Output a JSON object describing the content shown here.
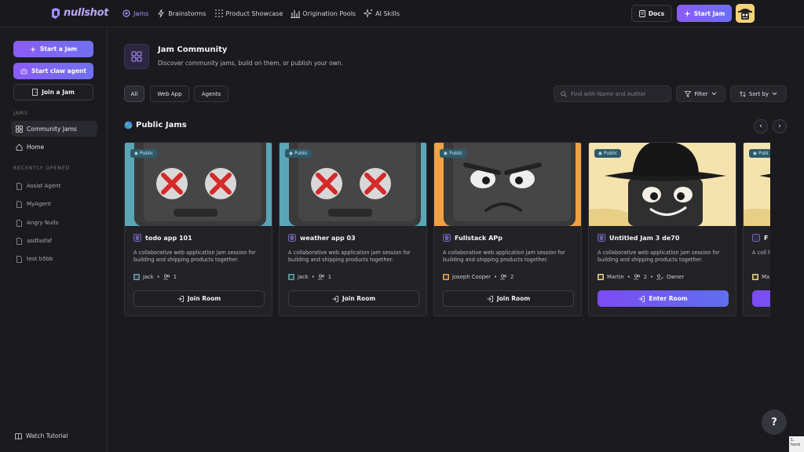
{
  "brand": {
    "name": "nullshot"
  },
  "nav": {
    "items": [
      {
        "label": "Jams",
        "icon": "jams-icon",
        "active": true
      },
      {
        "label": "Brainstorms",
        "icon": "bolt-icon"
      },
      {
        "label": "Product Showcase",
        "icon": "grid-dots-icon"
      },
      {
        "label": "Origination Pools",
        "icon": "bar-chart-icon"
      },
      {
        "label": "AI Skills",
        "icon": "sparkle-icon"
      }
    ],
    "docs_label": "Docs",
    "start_jam_label": "Start Jam"
  },
  "sidebar": {
    "start_jam": "Start a Jam",
    "start_claw": "Start claw agent",
    "join_jam": "Join a Jam",
    "section_jams": "JAMS",
    "community": "Community Jams",
    "home": "Home",
    "section_recent": "RECENTLY OPENED",
    "recent": [
      "Assist Agent",
      "MyAgent",
      "Angry Nulls",
      "asdfasfaf",
      "test b5bb"
    ],
    "watch": "Watch Tutorial"
  },
  "header": {
    "title": "Jam Community",
    "subtitle": "Discover community jams, build on them, or publish your own."
  },
  "filters": {
    "all": "All",
    "web_app": "Web App",
    "agents": "Agents"
  },
  "search": {
    "placeholder": "Find with Name and Author"
  },
  "toolbar": {
    "filter": "Filter",
    "sort": "Sort by"
  },
  "section": {
    "title": "Public Jams",
    "icon": "globe-icon"
  },
  "cards": [
    {
      "badge": "Public",
      "title": "todo app 101",
      "desc": "A collaborative web application jam session for building and shipping products together.",
      "author": "jack",
      "members": "1",
      "button": "Join Room",
      "bg": "#5aa6b6",
      "face": "x-eyes"
    },
    {
      "badge": "Public",
      "title": "weather app 03",
      "desc": "A collaborative web application jam session for building and shipping products together.",
      "author": "jack",
      "members": "1",
      "button": "Join Room",
      "bg": "#5aa6b6",
      "face": "x-eyes"
    },
    {
      "badge": "Public",
      "title": "Fullstack APp",
      "desc": "A collaborative web application jam session for building and shipping products together.",
      "author": "Joseph Cooper",
      "members": "2",
      "button": "Join Room",
      "bg": "#f2a144",
      "face": "angry"
    },
    {
      "badge": "Public",
      "title": "Untitled Jam 3 de70",
      "desc": "A collaborative web application jam session for building and shipping products together.",
      "author": "Martin",
      "members": "2",
      "role": "Owner",
      "button": "Enter Room",
      "bg": "#f5e3ae",
      "face": "hat"
    },
    {
      "badge": "Publ",
      "title": "F",
      "desc": "A coll for buil",
      "author": "Ma",
      "members": "",
      "button": "",
      "bg": "#f5e3ae",
      "face": "hat"
    }
  ],
  "help": {
    "label": "?"
  },
  "corner": {
    "label": "1. horsi"
  }
}
